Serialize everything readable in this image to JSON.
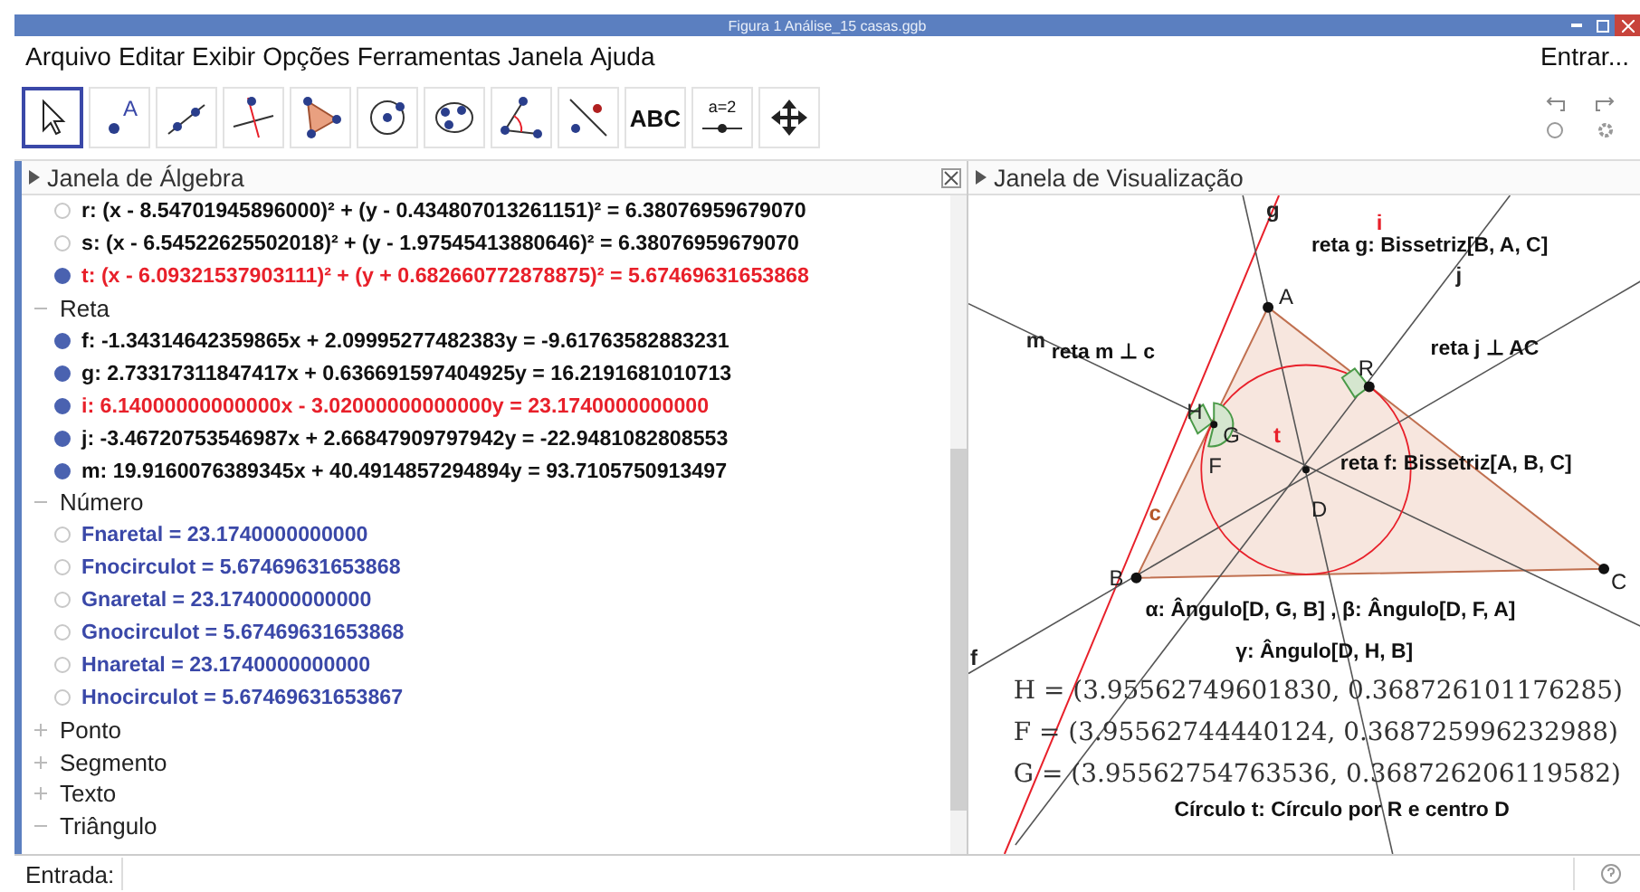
{
  "window": {
    "title": "Figura 1 Análise_15 casas.ggb"
  },
  "menu": [
    "Arquivo",
    "Editar",
    "Exibir",
    "Opções",
    "Ferramentas",
    "Janela",
    "Ajuda"
  ],
  "sign_in": "Entrar...",
  "tools": [
    {
      "kind": "move",
      "selected": true
    },
    {
      "kind": "point",
      "label": "A",
      "selected": false
    },
    {
      "kind": "line",
      "selected": false
    },
    {
      "kind": "perpendicular",
      "selected": false
    },
    {
      "kind": "polygon",
      "selected": false
    },
    {
      "kind": "circle",
      "selected": false
    },
    {
      "kind": "ellipse",
      "selected": false
    },
    {
      "kind": "angle",
      "selected": false
    },
    {
      "kind": "reflect",
      "selected": false
    },
    {
      "kind": "text",
      "label": "ABC",
      "selected": false
    },
    {
      "kind": "slider",
      "label": "a=2",
      "selected": false
    },
    {
      "kind": "pan",
      "selected": false
    }
  ],
  "algebra": {
    "title": "Janela de Álgebra",
    "leading_items": [
      {
        "text": "r: (x - 8.54701945896000)² + (y - 0.434807013261151)² = 6.38076959679070",
        "shown": false,
        "color": "#111111"
      },
      {
        "text": "s: (x - 6.54522625502018)² + (y - 1.97545413880646)² = 6.38076959679070",
        "shown": false,
        "color": "#111111"
      },
      {
        "text": "t: (x - 6.09321537903111)² + (y + 0.682660772878875)² = 5.67469631653868",
        "shown": true,
        "color": "#e8202a"
      }
    ],
    "groups": [
      {
        "label": "Reta",
        "expanded": true,
        "items": [
          {
            "text": "f: -1.34314642359865x + 2.09995277482383y = -9.61763582883231",
            "shown": true,
            "color": "#111111"
          },
          {
            "text": "g: 2.73317311847417x + 0.636691597404925y = 16.2191681010713",
            "shown": true,
            "color": "#111111"
          },
          {
            "text": "i: 6.14000000000000x - 3.02000000000000y = 23.1740000000000",
            "shown": true,
            "color": "#e8202a"
          },
          {
            "text": "j: -3.46720753546987x + 2.66847909797942y = -22.9481082808553",
            "shown": true,
            "color": "#111111"
          },
          {
            "text": "m: 19.9160076389345x + 40.4914857294894y = 93.7105750913497",
            "shown": true,
            "color": "#111111"
          }
        ]
      },
      {
        "label": "Número",
        "expanded": true,
        "items": [
          {
            "text": "Fnaretal = 23.1740000000000",
            "shown": false,
            "color": "#3a48a8"
          },
          {
            "text": "Fnocirculot = 5.67469631653868",
            "shown": false,
            "color": "#3a48a8"
          },
          {
            "text": "Gnaretal = 23.1740000000000",
            "shown": false,
            "color": "#3a48a8"
          },
          {
            "text": "Gnocirculot = 5.67469631653868",
            "shown": false,
            "color": "#3a48a8"
          },
          {
            "text": "Hnaretal = 23.1740000000000",
            "shown": false,
            "color": "#3a48a8"
          },
          {
            "text": "Hnocirculot = 5.67469631653867",
            "shown": false,
            "color": "#3a48a8"
          }
        ]
      },
      {
        "label": "Ponto",
        "expanded": false
      },
      {
        "label": "Segmento",
        "expanded": false
      },
      {
        "label": "Texto",
        "expanded": false
      },
      {
        "label": "Triângulo",
        "expanded": true
      }
    ]
  },
  "graphics": {
    "title": "Janela de Visualização",
    "line_labels": [
      {
        "text": "g",
        "color": "#222222"
      },
      {
        "text": "i",
        "color": "#e8202a"
      },
      {
        "text": "j",
        "color": "#222222"
      },
      {
        "text": "m",
        "color": "#222222"
      },
      {
        "text": "c",
        "color": "#b5582a"
      },
      {
        "text": "t",
        "color": "#e8202a"
      },
      {
        "text": "f",
        "color": "#222222"
      }
    ],
    "point_labels": [
      "A",
      "R",
      "H",
      "G",
      "F",
      "D",
      "B",
      "C"
    ],
    "captions": [
      "reta g:  Bissetriz[B, A, C]",
      "reta m ⊥ c",
      "reta j ⊥ AC",
      "reta f: Bissetriz[A, B, C]",
      "α:  Ângulo[D, G, B] ,  β:  Ângulo[D, F, A]",
      "γ:  Ângulo[D, H, B]"
    ],
    "coordinates": [
      "H = (3.95562749601830, 0.368726101176285)",
      "F = (3.95562744440124, 0.368725996232988)",
      "G = (3.95562754763536, 0.368726206119582)"
    ],
    "note": "Círculo t: Círculo por R e centro D"
  },
  "input": {
    "label": "Entrada:"
  }
}
